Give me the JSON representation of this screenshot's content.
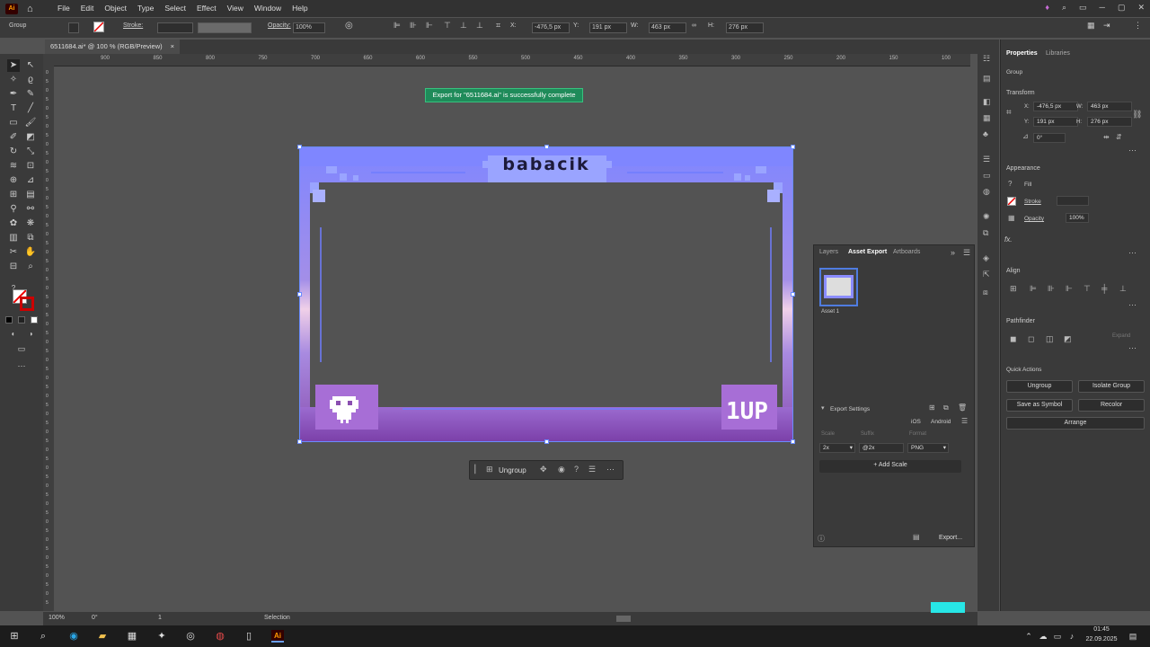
{
  "menubar": {
    "logo": "Ai",
    "items": [
      "File",
      "Edit",
      "Object",
      "Type",
      "Select",
      "Effect",
      "View",
      "Window",
      "Help"
    ]
  },
  "control_bar": {
    "selection": "Group",
    "stroke_label": "Stroke:",
    "opacity_label": "Opacity:",
    "opacity_value": "100%",
    "x_label": "X:",
    "x_value": "-476,5 px",
    "y_label": "Y:",
    "y_value": "191 px",
    "w_label": "W:",
    "w_value": "463 px",
    "h_label": "H:",
    "h_value": "276 px"
  },
  "document_tab": {
    "title": "6511684.ai* @ 100 % (RGB/Preview)",
    "close": "×"
  },
  "ruler_h": [
    "900",
    "850",
    "800",
    "750",
    "700",
    "650",
    "600",
    "550",
    "500",
    "450",
    "400",
    "350",
    "300",
    "250",
    "200",
    "150",
    "100"
  ],
  "ruler_v": [
    "0",
    "5",
    "0",
    "5",
    "0",
    "5",
    "0",
    "5",
    "0",
    "5",
    "0",
    "5",
    "0",
    "5",
    "0",
    "5",
    "0",
    "5",
    "0",
    "5",
    "0",
    "5",
    "0",
    "5",
    "0",
    "5",
    "0",
    "5",
    "0",
    "5",
    "0",
    "5",
    "0",
    "5",
    "0",
    "5",
    "0",
    "5",
    "0",
    "5",
    "0",
    "5",
    "0",
    "5",
    "0",
    "5",
    "0",
    "5",
    "0",
    "5",
    "0",
    "5",
    "0",
    "5",
    "0",
    "5",
    "0",
    "5",
    "0",
    "5"
  ],
  "toast": "Export for \"6511684.ai\" is successfully complete",
  "artboard": {
    "title": "babacik",
    "badge": "1UP",
    "colors": {
      "top": "#7f86ff",
      "bottom": "#8a4fb0",
      "inner": "#535353",
      "line": "#6f7cff"
    }
  },
  "context_bar": {
    "ungroup": "Ungroup"
  },
  "properties_panel": {
    "tabs": [
      "Properties",
      "Libraries"
    ],
    "group_label": "Group",
    "transform": {
      "title": "Transform",
      "x_label": "X:",
      "x": "-476,5 px",
      "w_label": "W:",
      "w": "463 px",
      "y_label": "Y:",
      "y": "191 px",
      "h_label": "H:",
      "h": "276 px",
      "angle": "0°"
    },
    "appearance": {
      "title": "Appearance",
      "fill": "Fill",
      "stroke": "Stroke",
      "opacity": "Opacity",
      "opacity_value": "100%",
      "fx": "fx."
    },
    "align": {
      "title": "Align"
    },
    "pathfinder": {
      "title": "Pathfinder",
      "expand": "Expand"
    },
    "quick_actions": {
      "title": "Quick Actions",
      "ungroup": "Ungroup",
      "isolate_group": "Isolate Group",
      "save_as_symbol": "Save as Symbol",
      "recolor": "Recolor",
      "arrange": "Arrange"
    }
  },
  "asset_panel": {
    "tabs": [
      "Layers",
      "Asset Export",
      "Artboards"
    ],
    "asset_name": "Asset 1",
    "export_settings": "Export Settings",
    "ios": "iOS",
    "android": "Android",
    "scale_label": "Scale",
    "suffix_label": "Suffix",
    "format_label": "Format",
    "scale_value": "2x",
    "suffix_value": "@2x",
    "format_value": "PNG",
    "add_scale": "Add Scale",
    "export_button": "Export..."
  },
  "status_bar": {
    "zoom": "100%",
    "rotation": "0°",
    "artboard_num": "1",
    "tool": "Selection"
  },
  "taskbar": {
    "time": "01:45",
    "date": "22.09.2025",
    "app_label": "Ai"
  }
}
